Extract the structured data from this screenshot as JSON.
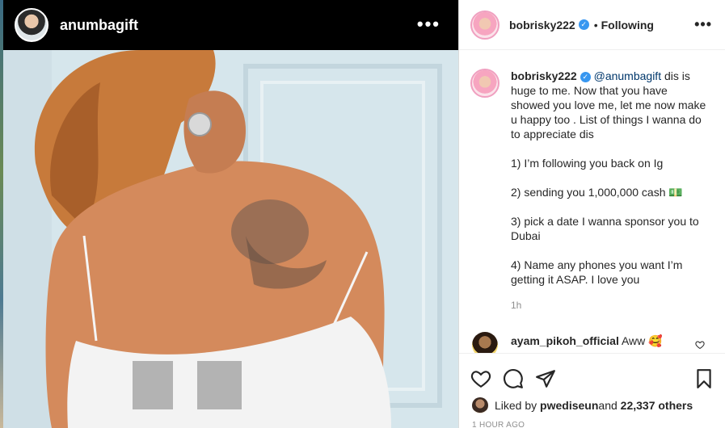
{
  "story": {
    "username": "anumbagift",
    "more_label": "•••"
  },
  "post_header": {
    "username": "bobrisky222",
    "verified_mark": "✓",
    "separator": "•",
    "follow_status": "Following",
    "more_label": "•••"
  },
  "caption": {
    "username": "bobrisky222",
    "mention": "@anumbagift",
    "intro": " dis is huge to me. Now that you have showed you love me, let me now make u happy too . List of things I wanna do to appreciate dis",
    "items": [
      "1) I’m following you back on Ig",
      "2) sending you 1,000,000 cash 💵",
      "3) pick a date I wanna sponsor you to Dubai",
      "4) Name any phones you want I’m getting it ASAP. I love you"
    ],
    "time": "1h"
  },
  "comment": {
    "username": "ayam_pikoh_official",
    "text": " Aww 🥰"
  },
  "actions": {
    "icons": [
      "heart-icon",
      "comment-icon",
      "share-icon",
      "bookmark-icon"
    ]
  },
  "likes": {
    "prefix": "Liked by ",
    "user": "pwediseun",
    "middle": " and ",
    "others": "22,337 others"
  },
  "post_time": "1 HOUR AGO",
  "colors": {
    "link": "#00376b",
    "verified": "#3897f0",
    "muted": "#8e8e8e"
  }
}
